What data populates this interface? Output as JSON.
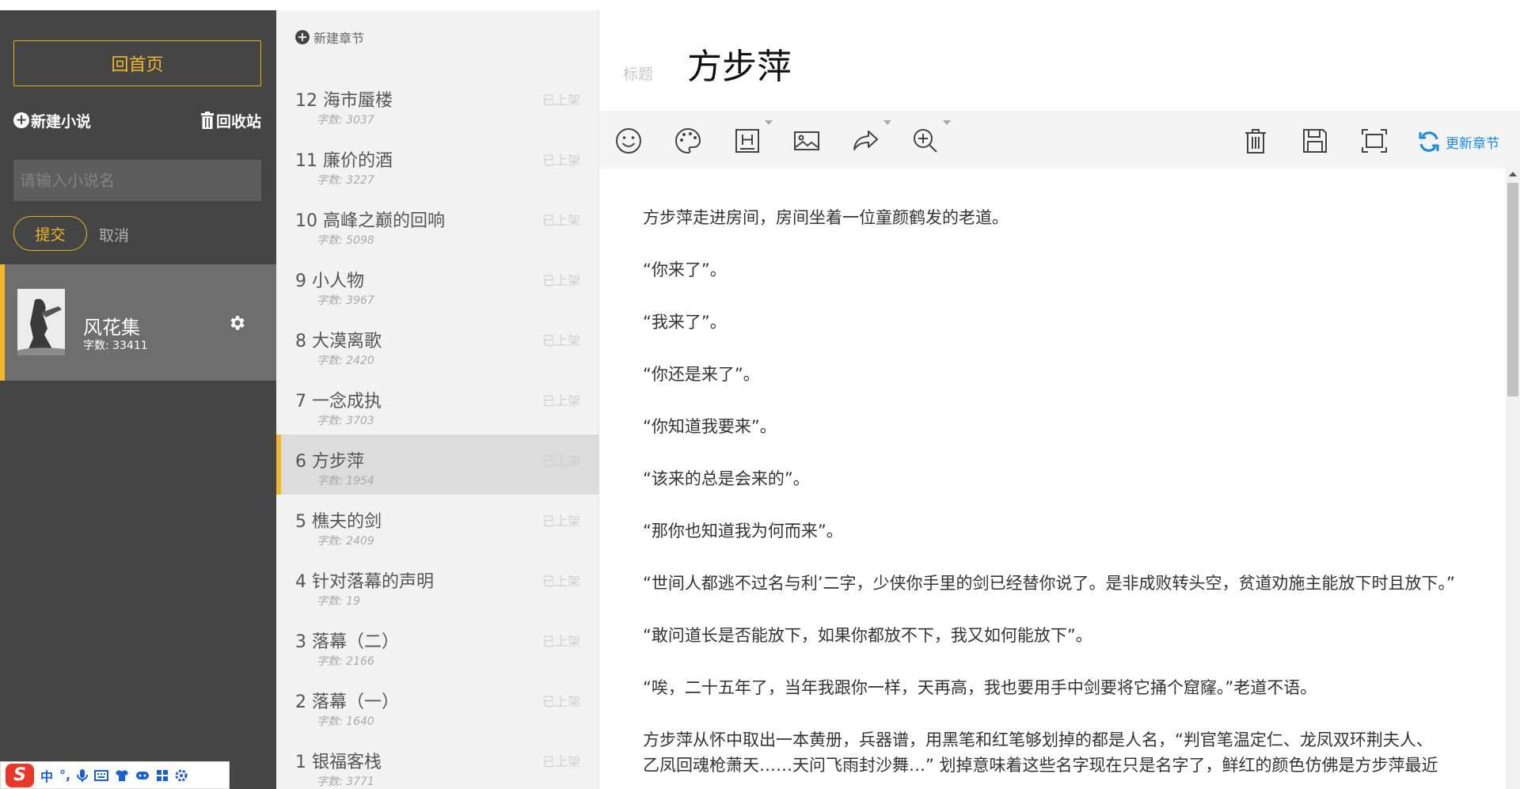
{
  "sidebar": {
    "home_label": "回首页",
    "new_novel_label": "新建小说",
    "recycle_label": "回收站",
    "novel_name_placeholder": "请输入小说名",
    "submit_label": "提交",
    "cancel_label": "取消",
    "novel": {
      "title": "风花集",
      "word_count": "字数: 33411"
    }
  },
  "chapters": {
    "new_chapter_label": "新建章节",
    "items": [
      {
        "title": "12  海市蜃楼",
        "count": "字数: 3037",
        "status": "已上架"
      },
      {
        "title": "11  廉价的酒",
        "count": "字数: 3227",
        "status": "已上架"
      },
      {
        "title": "10  高峰之巅的回响",
        "count": "字数: 5098",
        "status": "已上架"
      },
      {
        "title": "9  小人物",
        "count": "字数: 3967",
        "status": "已上架"
      },
      {
        "title": "8  大漠离歌",
        "count": "字数: 2420",
        "status": "已上架"
      },
      {
        "title": "7  一念成执",
        "count": "字数: 3703",
        "status": "已上架"
      },
      {
        "title": "6  方步萍",
        "count": "字数: 1954",
        "status": "已上架"
      },
      {
        "title": "5  樵夫的剑",
        "count": "字数: 2409",
        "status": "已上架"
      },
      {
        "title": "4  针对落幕的声明",
        "count": "字数: 19",
        "status": "已上架"
      },
      {
        "title": "3  落幕（二）",
        "count": "字数: 2166",
        "status": "已上架"
      },
      {
        "title": "2  落幕（一）",
        "count": "字数: 1640",
        "status": "已上架"
      },
      {
        "title": "1  银福客栈",
        "count": "字数: 3771",
        "status": "已上架"
      }
    ]
  },
  "editor": {
    "title_label": "标题",
    "title": "方步萍",
    "update_label": "更新章节",
    "paragraphs": [
      "方步萍走进房间，房间坐着一位童颜鹤发的老道。",
      "“你来了”。",
      "“我来了”。",
      "“你还是来了”。",
      "“你知道我要来”。",
      "“该来的总是会来的”。",
      "“那你也知道我为何而来”。",
      "“世间人都逃不过名与利’二字，少侠你手里的剑已经替你说了。是非成败转头空，贫道劝施主能放下时且放下。”",
      "“敢问道长是否能放下，如果你都放不下，我又如何能放下”。",
      "“唉，二十五年了，当年我跟你一样，天再高，我也要用手中剑要将它捅个窟窿。”老道不语。",
      "方步萍从怀中取出一本黄册，兵器谱，用黑笔和红笔够划掉的都是人名，“判官笔温定仁、龙凤双环荆夫人、"
    ],
    "last_line": "乙凤回魂枪萧天……天问飞雨封沙舞…”  划掉意味着这些名字现在只是名字了，鲜红的颜色仿佛是方步萍最近"
  },
  "ime": {
    "lang": "中",
    "punct": "°,"
  },
  "colors": {
    "accent": "#f0b82a",
    "link": "#1a8ae0",
    "sidebar_bg": "#454545"
  }
}
